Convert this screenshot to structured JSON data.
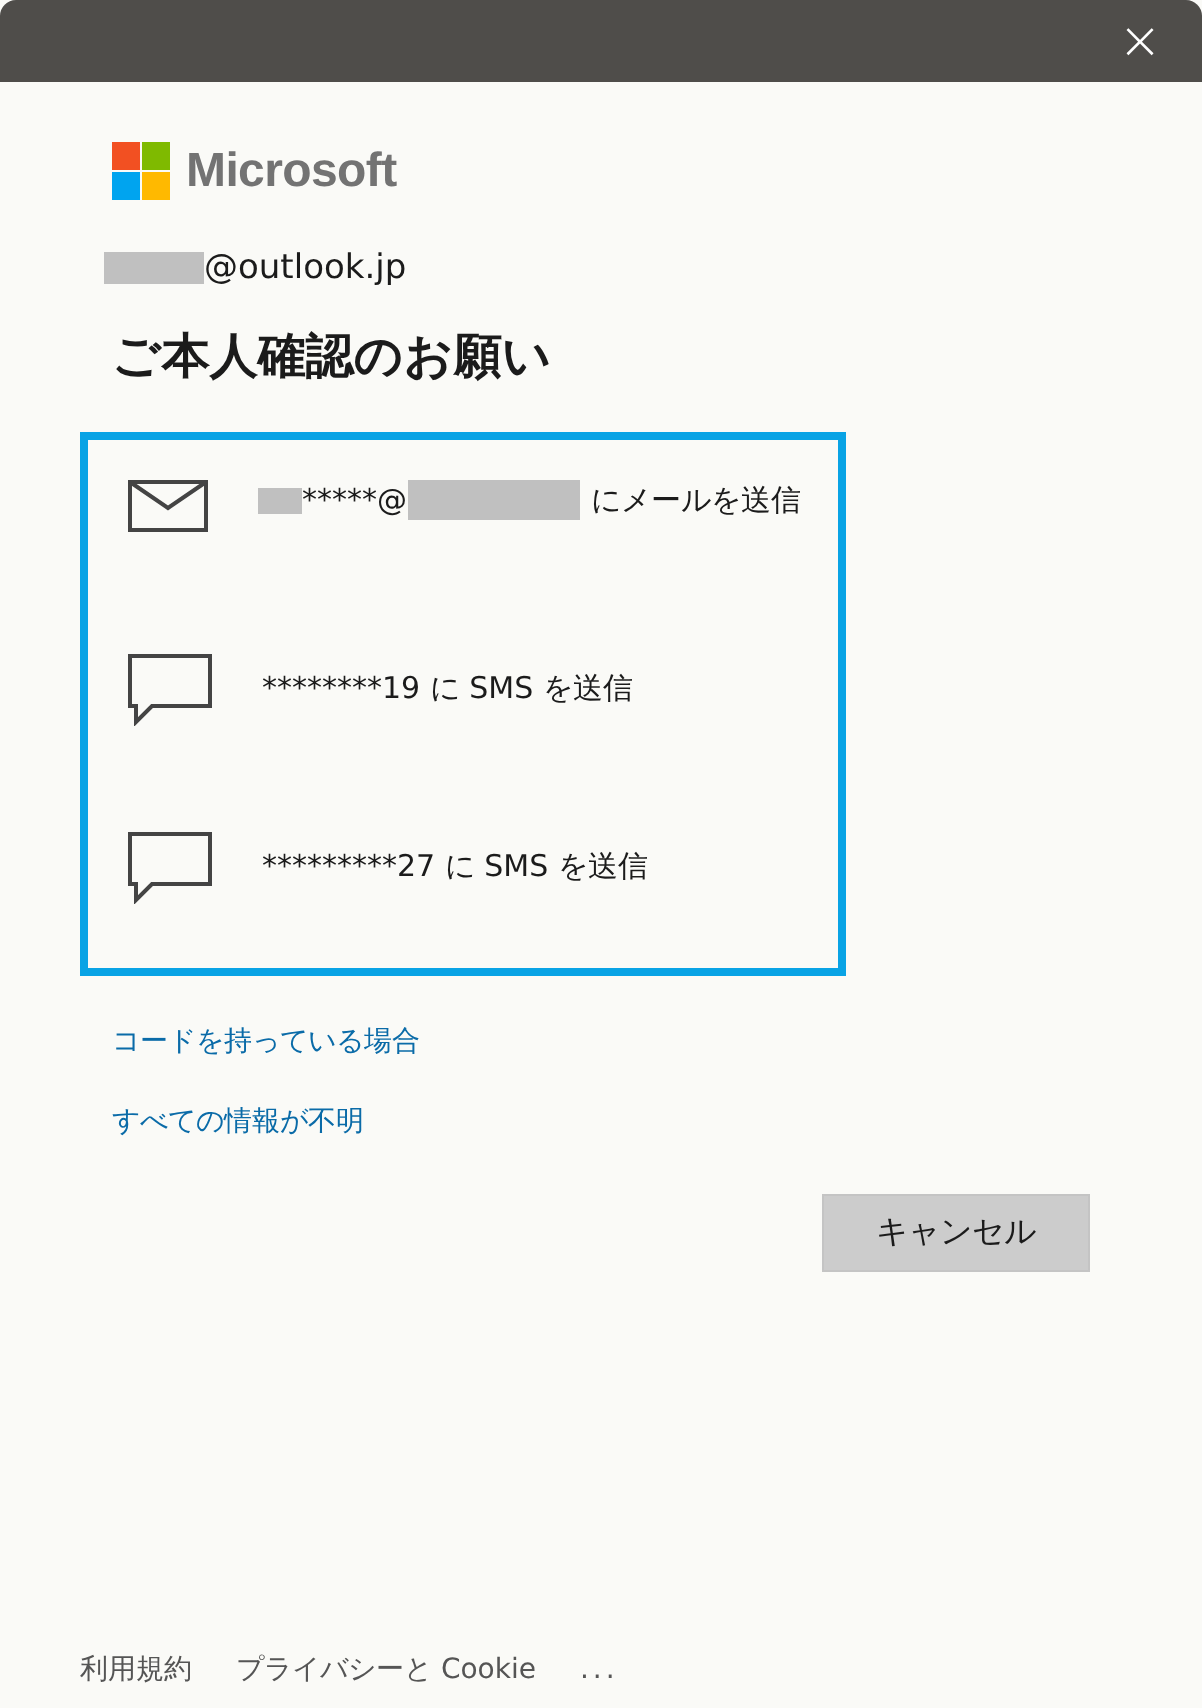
{
  "window": {
    "close": "×"
  },
  "brand": {
    "name": "Microsoft"
  },
  "account": {
    "redacted_prefix": true,
    "text": "@outlook.jp"
  },
  "heading": "ご本人確認のお願い",
  "options_focused": true,
  "options": [
    {
      "kind": "email",
      "parts": [
        {
          "kind": "redacted",
          "wide": false
        },
        {
          "kind": "text",
          "text": "*****@"
        },
        {
          "kind": "redacted",
          "wide": true
        },
        {
          "kind": "text",
          "text": "にメールを送信"
        }
      ]
    },
    {
      "kind": "sms",
      "parts": [
        {
          "kind": "text",
          "text": "********19 に SMS を送信"
        }
      ]
    },
    {
      "kind": "sms",
      "parts": [
        {
          "kind": "text",
          "text": "*********27 に SMS を送信"
        }
      ]
    }
  ],
  "links": [
    "コードを持っている場合",
    "すべての情報が不明"
  ],
  "buttons": [
    "キャンセル"
  ],
  "footer": {
    "links": [
      "利用規約",
      "プライバシーと Cookie"
    ],
    "more": "..."
  }
}
